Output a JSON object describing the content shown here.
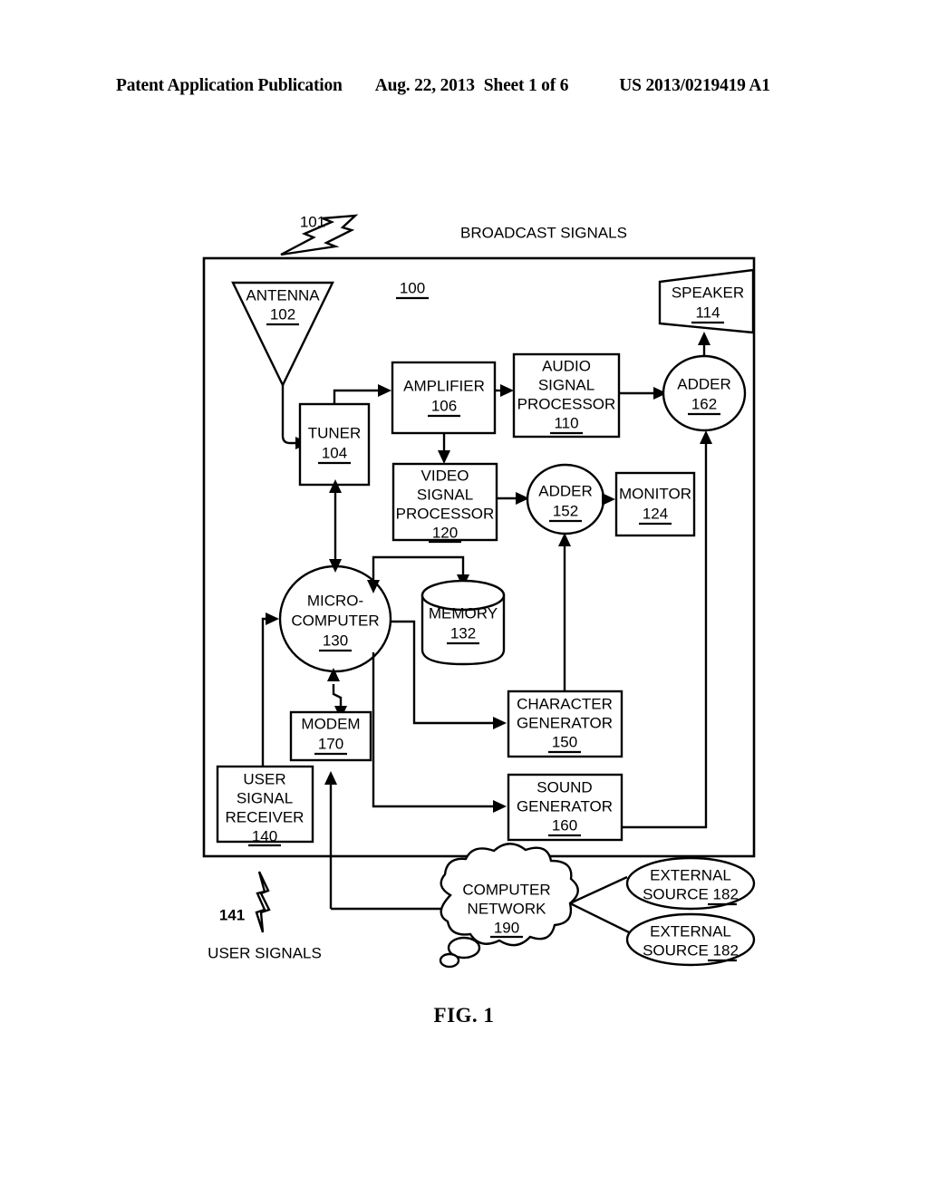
{
  "header": {
    "publication": "Patent Application Publication",
    "date": "Aug. 22, 2013",
    "sheet": "Sheet 1 of 6",
    "number": "US 2013/0219419 A1"
  },
  "figure": {
    "caption": "FIG. 1",
    "system_ref": "100",
    "broadcast_label": "BROADCAST SIGNALS",
    "broadcast_ref": "101",
    "user_signals_label": "USER SIGNALS",
    "user_signals_ref": "141"
  },
  "blocks": {
    "antenna": {
      "label": "ANTENNA",
      "ref": "102"
    },
    "tuner": {
      "label": "TUNER",
      "ref": "104"
    },
    "amplifier": {
      "label": "AMPLIFIER",
      "ref": "106"
    },
    "audio_processor": {
      "line1": "AUDIO",
      "line2": "SIGNAL",
      "line3": "PROCESSOR",
      "ref": "110"
    },
    "video_processor": {
      "line1": "VIDEO",
      "line2": "SIGNAL",
      "line3": "PROCESSOR",
      "ref": "120"
    },
    "speaker": {
      "label": "SPEAKER",
      "ref": "114"
    },
    "adder_162": {
      "label": "ADDER",
      "ref": "162"
    },
    "adder_152": {
      "label": "ADDER",
      "ref": "152"
    },
    "monitor": {
      "label": "MONITOR",
      "ref": "124"
    },
    "microcomputer": {
      "line1": "MICRO-",
      "line2": "COMPUTER",
      "ref": "130"
    },
    "memory": {
      "label": "MEMORY",
      "ref": "132"
    },
    "modem": {
      "label": "MODEM",
      "ref": "170"
    },
    "user_signal_receiver": {
      "line1": "USER",
      "line2": "SIGNAL",
      "line3": "RECEIVER",
      "ref": "140"
    },
    "character_generator": {
      "line1": "CHARACTER",
      "line2": "GENERATOR",
      "ref": "150"
    },
    "sound_generator": {
      "line1": "SOUND",
      "line2": "GENERATOR",
      "ref": "160"
    },
    "computer_network": {
      "line1": "COMPUTER",
      "line2": "NETWORK",
      "ref": "190"
    },
    "external_source_1": {
      "line1": "EXTERNAL",
      "line2": "SOURCE 182"
    },
    "external_source_2": {
      "line1": "EXTERNAL",
      "line2": "SOURCE 182"
    }
  },
  "colors": {
    "ink": "#000000",
    "paper": "#ffffff"
  }
}
